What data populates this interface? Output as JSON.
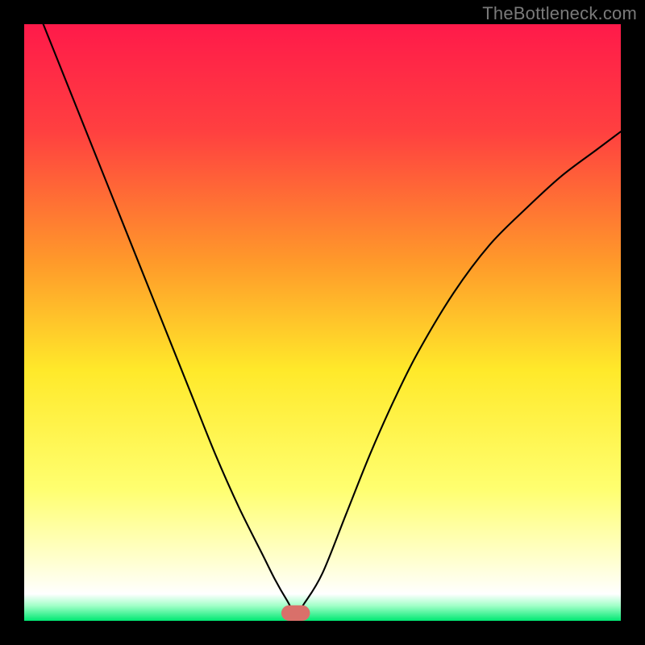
{
  "watermark": "TheBottleneck.com",
  "chart_data": {
    "type": "line",
    "title": "",
    "xlabel": "",
    "ylabel": "",
    "xlim": [
      0,
      100
    ],
    "ylim": [
      0,
      100
    ],
    "background_gradient": {
      "stops": [
        {
          "offset": 0.0,
          "color": "#ff1a4a"
        },
        {
          "offset": 0.18,
          "color": "#ff4040"
        },
        {
          "offset": 0.4,
          "color": "#ff9a2a"
        },
        {
          "offset": 0.58,
          "color": "#ffe92a"
        },
        {
          "offset": 0.78,
          "color": "#ffff70"
        },
        {
          "offset": 0.9,
          "color": "#ffffd0"
        },
        {
          "offset": 0.955,
          "color": "#ffffff"
        },
        {
          "offset": 0.975,
          "color": "#9fffc7"
        },
        {
          "offset": 1.0,
          "color": "#00e873"
        }
      ]
    },
    "marker": {
      "x": 45.5,
      "y": 1.3,
      "rx": 2.4,
      "ry": 1.3,
      "color": "#d9706a"
    },
    "series": [
      {
        "name": "curve",
        "color": "#000000",
        "stroke_width": 2.1,
        "x": [
          0,
          4,
          8,
          12,
          16,
          20,
          24,
          28,
          32,
          36,
          40,
          42,
          44,
          45.5,
          47,
          50,
          54,
          58,
          62,
          66,
          72,
          78,
          84,
          90,
          96,
          100
        ],
        "values": [
          108,
          98,
          88,
          78,
          68,
          58,
          48,
          38,
          28,
          19,
          11,
          7,
          3.5,
          1.3,
          3.0,
          8,
          18,
          28,
          37,
          45,
          55,
          63,
          69,
          74.5,
          79,
          82
        ]
      }
    ]
  }
}
